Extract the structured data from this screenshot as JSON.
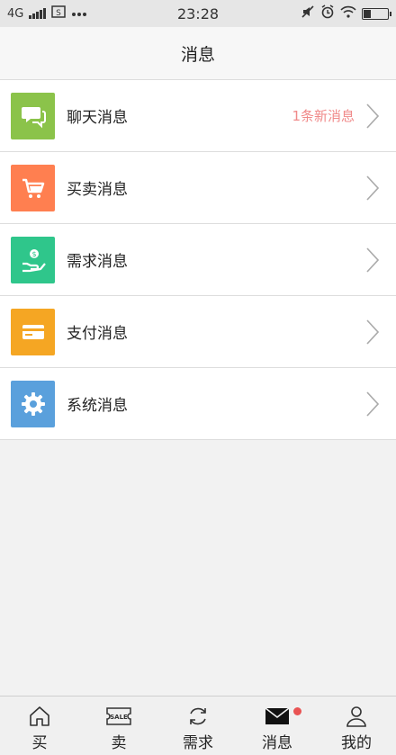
{
  "status_bar": {
    "network": "4G",
    "time": "23:28",
    "icons": [
      "signal-icon",
      "sim-icon",
      "more-dots-icon",
      "mute-icon",
      "alarm-icon",
      "wifi-icon",
      "battery-icon"
    ]
  },
  "header": {
    "title": "消息"
  },
  "rows": [
    {
      "label": "聊天消息",
      "badge": "1条新消息",
      "icon": "chat-bubbles-icon",
      "color": "#8bc34a"
    },
    {
      "label": "买卖消息",
      "badge": "",
      "icon": "cart-icon",
      "color": "#ff7f50"
    },
    {
      "label": "需求消息",
      "badge": "",
      "icon": "hand-coin-icon",
      "color": "#2fc68b"
    },
    {
      "label": "支付消息",
      "badge": "",
      "icon": "card-icon",
      "color": "#f5a623"
    },
    {
      "label": "系统消息",
      "badge": "",
      "icon": "gear-icon",
      "color": "#5aa0dc"
    }
  ],
  "tabs": [
    {
      "label": "买",
      "icon": "home-icon"
    },
    {
      "label": "卖",
      "icon": "sale-tag-icon",
      "icon_text": "SALE"
    },
    {
      "label": "需求",
      "icon": "refresh-icon"
    },
    {
      "label": "消息",
      "icon": "envelope-icon",
      "has_dot": true
    },
    {
      "label": "我的",
      "icon": "user-icon"
    }
  ],
  "colors": {
    "badge_text": "#f08a8a",
    "notification_dot": "#e95353"
  }
}
